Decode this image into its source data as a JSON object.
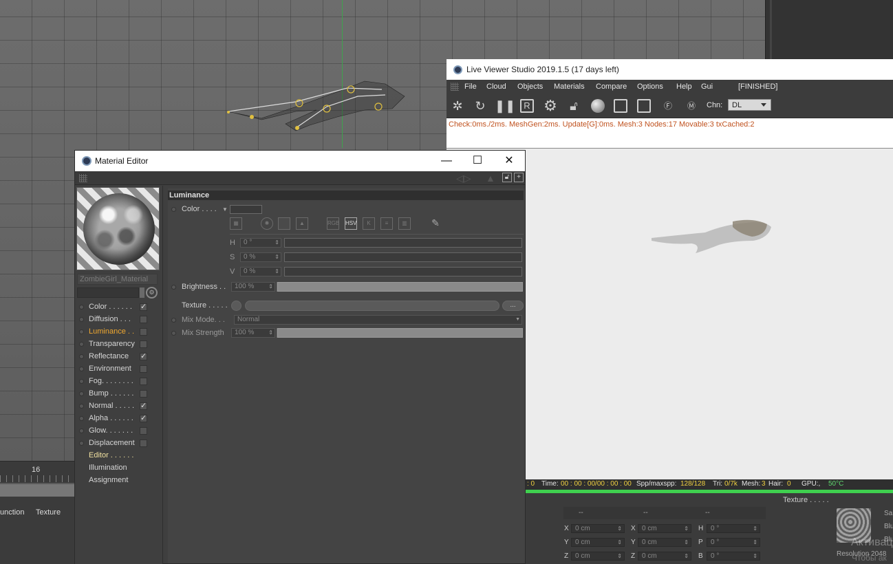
{
  "viewport": {
    "timeline_number": "16",
    "bottom_left_labels": [
      "unction",
      "Texture"
    ]
  },
  "live_viewer": {
    "title": "Live Viewer Studio 2019.1.5 (17 days left)",
    "menu": [
      "File",
      "Cloud",
      "Objects",
      "Materials",
      "Compare",
      "Options",
      "Help",
      "Gui"
    ],
    "state": "[FINISHED]",
    "toolbar_icons": [
      "aperture-icon",
      "refresh-icon",
      "pause-icon",
      "render-icon",
      "gear-icon",
      "lock-icon",
      "sphere-icon",
      "region-icon",
      "region2-icon",
      "pin-f-icon",
      "pin-m-icon"
    ],
    "chn_label": "Chn:",
    "chn_value": "DL",
    "status": "Check:0ms./2ms. MeshGen:2ms. Update[G]:0ms. Mesh:3 Nodes:17 Movable:3 txCached:2",
    "info": {
      "zero": ": 0",
      "time_label": "Time:",
      "time_value": "00 : 00 : 00/00 : 00 : 00",
      "spp_label": "Spp/maxspp:",
      "spp_value": "128/128",
      "tri_label": "Tri:",
      "tri_value": "0/7k",
      "mesh_label": "Mesh:",
      "mesh_value": "3",
      "hair_label": "Hair:",
      "hair_value": "0",
      "gpu_label": "GPU:,",
      "temp": "50°C"
    }
  },
  "material_editor": {
    "title": "Material Editor",
    "material_name": "ZombieGirl_Material",
    "channels": [
      {
        "label": "Color . . . . . .",
        "checked": true
      },
      {
        "label": "Diffusion . . .",
        "checked": false
      },
      {
        "label": "Luminance . .",
        "checked": false,
        "active": true
      },
      {
        "label": "Transparency",
        "checked": false
      },
      {
        "label": "Reflectance",
        "checked": true
      },
      {
        "label": "Environment",
        "checked": false
      },
      {
        "label": "Fog. . . . . . . .",
        "checked": false
      },
      {
        "label": "Bump . . . . . .",
        "checked": false
      },
      {
        "label": "Normal . . . . .",
        "checked": true
      },
      {
        "label": "Alpha . . . . . .",
        "checked": true
      },
      {
        "label": "Glow. . . . . . .",
        "checked": false
      },
      {
        "label": "Displacement",
        "checked": false
      }
    ],
    "sections": [
      {
        "label": "Editor . . . . . ."
      },
      {
        "label": "Illumination"
      },
      {
        "label": "Assignment"
      }
    ],
    "section_title": "Luminance",
    "color_label": "Color . . . .",
    "color_modes": [
      "RGB",
      "HSV",
      "K"
    ],
    "h_label": "H",
    "h_value": "0 °",
    "s_label": "S",
    "s_value": "0 %",
    "v_label": "V",
    "v_value": "0 %",
    "brightness_label": "Brightness . .",
    "brightness_value": "100 %",
    "brightness_fraction": 1.0,
    "texture_label": "Texture . . . . .",
    "texture_btn": "...",
    "mix_mode_label": "Mix Mode. . .",
    "mix_mode_value": "Normal",
    "mix_strength_label": "Mix Strength",
    "mix_strength_value": "100 %",
    "mix_strength_fraction": 1.0
  },
  "attributes": {
    "header_dashes": [
      "--",
      "--",
      "--"
    ],
    "rows": [
      {
        "a": "X",
        "av": "0 cm",
        "b": "X",
        "bv": "0 cm",
        "c": "H",
        "cv": "0 °"
      },
      {
        "a": "Y",
        "av": "0 cm",
        "b": "Y",
        "bv": "0 cm",
        "c": "P",
        "cv": "0 °"
      },
      {
        "a": "Z",
        "av": "0 cm",
        "b": "Z",
        "bv": "0 cm",
        "c": "B",
        "cv": "0 °"
      }
    ],
    "texture_label": "Texture . . . . .",
    "side_labels": [
      "Samp",
      "Blur C",
      "Blur S"
    ],
    "resolution": "Resolution 2048",
    "watermark_1": "Активация",
    "watermark_2": "Чтобы ак"
  }
}
